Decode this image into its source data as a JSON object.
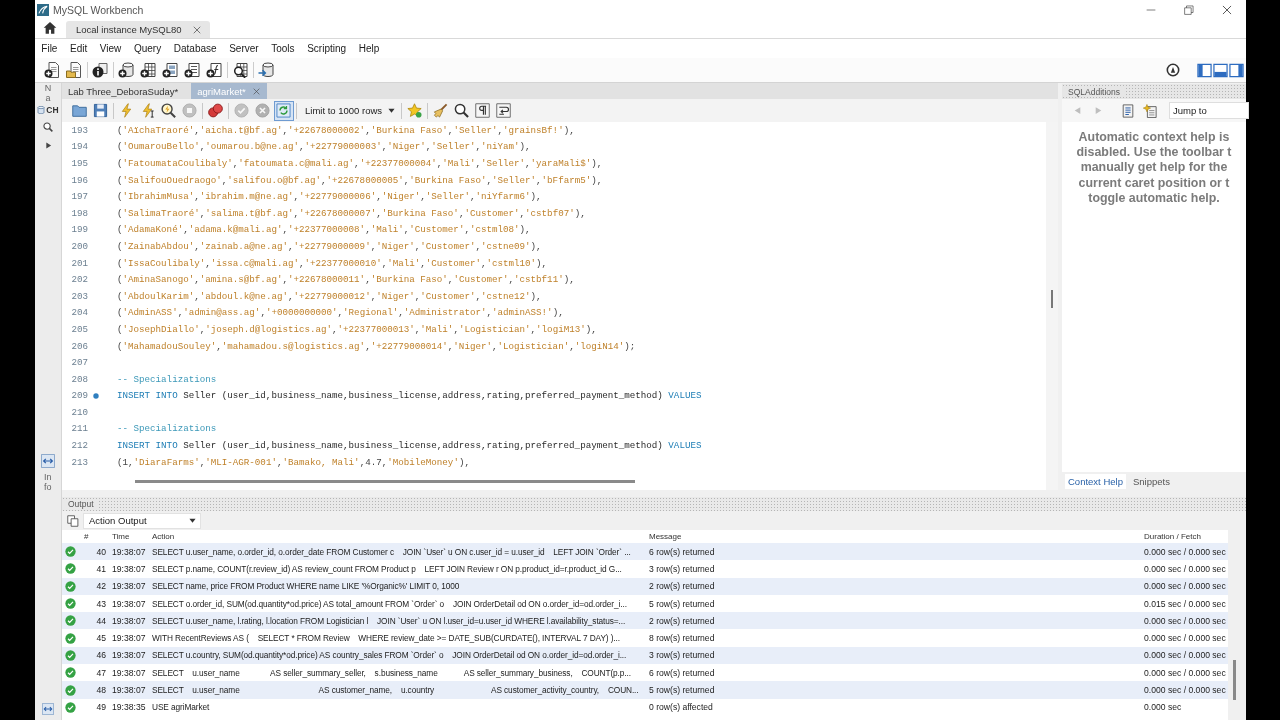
{
  "window": {
    "title": "MySQL Workbench"
  },
  "connection_tabs": [
    {
      "label": "Local instance MySQL80",
      "selected": true
    }
  ],
  "menu": [
    "File",
    "Edit",
    "View",
    "Query",
    "Database",
    "Server",
    "Tools",
    "Scripting",
    "Help"
  ],
  "sidebar": {
    "navigator_label": "Na",
    "schemas_label": "CH",
    "info_label": "Info"
  },
  "editor_tabs": [
    {
      "label": "Lab Three_DeboraSuday*",
      "selected": false
    },
    {
      "label": "agriMarket*",
      "selected": true
    }
  ],
  "editor_toolbar": [
    {
      "kind": "button",
      "disabled": false,
      "on": false
    },
    {
      "kind": "button",
      "disabled": false,
      "on": false
    },
    {
      "kind": "button",
      "disabled": false,
      "on": false
    },
    {
      "kind": "button",
      "disabled": false,
      "on": false
    },
    {
      "kind": "button",
      "disabled": false,
      "on": false
    },
    {
      "kind": "button",
      "disabled": true,
      "on": false
    },
    {
      "kind": "button",
      "disabled": false,
      "on": false
    },
    {
      "kind": "button",
      "disabled": true,
      "on": false
    },
    {
      "kind": "button",
      "disabled": true,
      "on": false
    },
    {
      "kind": "button",
      "disabled": false,
      "on": true
    },
    {
      "kind": "dropdown",
      "label": "Limit to 1000 rows"
    },
    {
      "kind": "button",
      "disabled": false,
      "on": false
    },
    {
      "kind": "button",
      "disabled": false,
      "on": false
    },
    {
      "kind": "button",
      "disabled": false,
      "on": false
    },
    {
      "kind": "button",
      "disabled": false,
      "on": false
    },
    {
      "kind": "button",
      "disabled": false,
      "on": false
    }
  ],
  "editor": {
    "lines": [
      {
        "number": "193",
        "marker": false,
        "tokens": [
          {
            "kind": "punct",
            "text": "("
          },
          {
            "kind": "string",
            "text": "'AïchaTraoré'"
          },
          {
            "kind": "punct",
            "text": ","
          },
          {
            "kind": "string",
            "text": "'aicha.t@bf.ag'"
          },
          {
            "kind": "punct",
            "text": ","
          },
          {
            "kind": "string",
            "text": "'+22678000002'"
          },
          {
            "kind": "punct",
            "text": ","
          },
          {
            "kind": "string",
            "text": "'Burkina Faso'"
          },
          {
            "kind": "punct",
            "text": ","
          },
          {
            "kind": "string",
            "text": "'Seller'"
          },
          {
            "kind": "punct",
            "text": ","
          },
          {
            "kind": "string",
            "text": "'grainsBf!'"
          },
          {
            "kind": "punct",
            "text": "),"
          }
        ]
      },
      {
        "number": "194",
        "marker": false,
        "tokens": [
          {
            "kind": "punct",
            "text": "("
          },
          {
            "kind": "string",
            "text": "'OumarouBello'"
          },
          {
            "kind": "punct",
            "text": ","
          },
          {
            "kind": "string",
            "text": "'oumarou.b@ne.ag'"
          },
          {
            "kind": "punct",
            "text": ","
          },
          {
            "kind": "string",
            "text": "'+22779000003'"
          },
          {
            "kind": "punct",
            "text": ","
          },
          {
            "kind": "string",
            "text": "'Niger'"
          },
          {
            "kind": "punct",
            "text": ","
          },
          {
            "kind": "string",
            "text": "'Seller'"
          },
          {
            "kind": "punct",
            "text": ","
          },
          {
            "kind": "string",
            "text": "'niYam'"
          },
          {
            "kind": "punct",
            "text": "),"
          }
        ]
      },
      {
        "number": "195",
        "marker": false,
        "tokens": [
          {
            "kind": "punct",
            "text": "("
          },
          {
            "kind": "string",
            "text": "'FatoumataCoulibaly'"
          },
          {
            "kind": "punct",
            "text": ","
          },
          {
            "kind": "string",
            "text": "'fatoumata.c@mali.ag'"
          },
          {
            "kind": "punct",
            "text": ","
          },
          {
            "kind": "string",
            "text": "'+22377000004'"
          },
          {
            "kind": "punct",
            "text": ","
          },
          {
            "kind": "string",
            "text": "'Mali'"
          },
          {
            "kind": "punct",
            "text": ","
          },
          {
            "kind": "string",
            "text": "'Seller'"
          },
          {
            "kind": "punct",
            "text": ","
          },
          {
            "kind": "string",
            "text": "'yaraMali$'"
          },
          {
            "kind": "punct",
            "text": "),"
          }
        ]
      },
      {
        "number": "196",
        "marker": false,
        "tokens": [
          {
            "kind": "punct",
            "text": "("
          },
          {
            "kind": "string",
            "text": "'SalifouOuedraogo'"
          },
          {
            "kind": "punct",
            "text": ","
          },
          {
            "kind": "string",
            "text": "'salifou.o@bf.ag'"
          },
          {
            "kind": "punct",
            "text": ","
          },
          {
            "kind": "string",
            "text": "'+22678000005'"
          },
          {
            "kind": "punct",
            "text": ","
          },
          {
            "kind": "string",
            "text": "'Burkina Faso'"
          },
          {
            "kind": "punct",
            "text": ","
          },
          {
            "kind": "string",
            "text": "'Seller'"
          },
          {
            "kind": "punct",
            "text": ","
          },
          {
            "kind": "string",
            "text": "'bFfarm5'"
          },
          {
            "kind": "punct",
            "text": "),"
          }
        ]
      },
      {
        "number": "197",
        "marker": false,
        "tokens": [
          {
            "kind": "punct",
            "text": "("
          },
          {
            "kind": "string",
            "text": "'IbrahimMusa'"
          },
          {
            "kind": "punct",
            "text": ","
          },
          {
            "kind": "string",
            "text": "'ibrahim.m@ne.ag'"
          },
          {
            "kind": "punct",
            "text": ","
          },
          {
            "kind": "string",
            "text": "'+22779000006'"
          },
          {
            "kind": "punct",
            "text": ","
          },
          {
            "kind": "string",
            "text": "'Niger'"
          },
          {
            "kind": "punct",
            "text": ","
          },
          {
            "kind": "string",
            "text": "'Seller'"
          },
          {
            "kind": "punct",
            "text": ","
          },
          {
            "kind": "string",
            "text": "'niYfarm6'"
          },
          {
            "kind": "punct",
            "text": "),"
          }
        ]
      },
      {
        "number": "198",
        "marker": false,
        "tokens": [
          {
            "kind": "punct",
            "text": "("
          },
          {
            "kind": "string",
            "text": "'SalimaTraoré'"
          },
          {
            "kind": "punct",
            "text": ","
          },
          {
            "kind": "string",
            "text": "'salima.t@bf.ag'"
          },
          {
            "kind": "punct",
            "text": ","
          },
          {
            "kind": "string",
            "text": "'+22678000007'"
          },
          {
            "kind": "punct",
            "text": ","
          },
          {
            "kind": "string",
            "text": "'Burkina Faso'"
          },
          {
            "kind": "punct",
            "text": ","
          },
          {
            "kind": "string",
            "text": "'Customer'"
          },
          {
            "kind": "punct",
            "text": ","
          },
          {
            "kind": "string",
            "text": "'cstbf07'"
          },
          {
            "kind": "punct",
            "text": "),"
          }
        ]
      },
      {
        "number": "199",
        "marker": false,
        "tokens": [
          {
            "kind": "punct",
            "text": "("
          },
          {
            "kind": "string",
            "text": "'AdamaKoné'"
          },
          {
            "kind": "punct",
            "text": ","
          },
          {
            "kind": "string",
            "text": "'adama.k@mali.ag'"
          },
          {
            "kind": "punct",
            "text": ","
          },
          {
            "kind": "string",
            "text": "'+22377000008'"
          },
          {
            "kind": "punct",
            "text": ","
          },
          {
            "kind": "string",
            "text": "'Mali'"
          },
          {
            "kind": "punct",
            "text": ","
          },
          {
            "kind": "string",
            "text": "'Customer'"
          },
          {
            "kind": "punct",
            "text": ","
          },
          {
            "kind": "string",
            "text": "'cstml08'"
          },
          {
            "kind": "punct",
            "text": "),"
          }
        ]
      },
      {
        "number": "200",
        "marker": false,
        "tokens": [
          {
            "kind": "punct",
            "text": "("
          },
          {
            "kind": "string",
            "text": "'ZainabAbdou'"
          },
          {
            "kind": "punct",
            "text": ","
          },
          {
            "kind": "string",
            "text": "'zainab.a@ne.ag'"
          },
          {
            "kind": "punct",
            "text": ","
          },
          {
            "kind": "string",
            "text": "'+22779000009'"
          },
          {
            "kind": "punct",
            "text": ","
          },
          {
            "kind": "string",
            "text": "'Niger'"
          },
          {
            "kind": "punct",
            "text": ","
          },
          {
            "kind": "string",
            "text": "'Customer'"
          },
          {
            "kind": "punct",
            "text": ","
          },
          {
            "kind": "string",
            "text": "'cstne09'"
          },
          {
            "kind": "punct",
            "text": "),"
          }
        ]
      },
      {
        "number": "201",
        "marker": false,
        "tokens": [
          {
            "kind": "punct",
            "text": "("
          },
          {
            "kind": "string",
            "text": "'IssaCoulibaly'"
          },
          {
            "kind": "punct",
            "text": ","
          },
          {
            "kind": "string",
            "text": "'issa.c@mali.ag'"
          },
          {
            "kind": "punct",
            "text": ","
          },
          {
            "kind": "string",
            "text": "'+22377000010'"
          },
          {
            "kind": "punct",
            "text": ","
          },
          {
            "kind": "string",
            "text": "'Mali'"
          },
          {
            "kind": "punct",
            "text": ","
          },
          {
            "kind": "string",
            "text": "'Customer'"
          },
          {
            "kind": "punct",
            "text": ","
          },
          {
            "kind": "string",
            "text": "'cstml10'"
          },
          {
            "kind": "punct",
            "text": "),"
          }
        ]
      },
      {
        "number": "202",
        "marker": false,
        "tokens": [
          {
            "kind": "punct",
            "text": "("
          },
          {
            "kind": "string",
            "text": "'AminaSanogo'"
          },
          {
            "kind": "punct",
            "text": ","
          },
          {
            "kind": "string",
            "text": "'amina.s@bf.ag'"
          },
          {
            "kind": "punct",
            "text": ","
          },
          {
            "kind": "string",
            "text": "'+22678000011'"
          },
          {
            "kind": "punct",
            "text": ","
          },
          {
            "kind": "string",
            "text": "'Burkina Faso'"
          },
          {
            "kind": "punct",
            "text": ","
          },
          {
            "kind": "string",
            "text": "'Customer'"
          },
          {
            "kind": "punct",
            "text": ","
          },
          {
            "kind": "string",
            "text": "'cstbf11'"
          },
          {
            "kind": "punct",
            "text": "),"
          }
        ]
      },
      {
        "number": "203",
        "marker": false,
        "tokens": [
          {
            "kind": "punct",
            "text": "("
          },
          {
            "kind": "string",
            "text": "'AbdoulKarim'"
          },
          {
            "kind": "punct",
            "text": ","
          },
          {
            "kind": "string",
            "text": "'abdoul.k@ne.ag'"
          },
          {
            "kind": "punct",
            "text": ","
          },
          {
            "kind": "string",
            "text": "'+22779000012'"
          },
          {
            "kind": "punct",
            "text": ","
          },
          {
            "kind": "string",
            "text": "'Niger'"
          },
          {
            "kind": "punct",
            "text": ","
          },
          {
            "kind": "string",
            "text": "'Customer'"
          },
          {
            "kind": "punct",
            "text": ","
          },
          {
            "kind": "string",
            "text": "'cstne12'"
          },
          {
            "kind": "punct",
            "text": "),"
          }
        ]
      },
      {
        "number": "204",
        "marker": false,
        "tokens": [
          {
            "kind": "punct",
            "text": "("
          },
          {
            "kind": "string",
            "text": "'AdminASS'"
          },
          {
            "kind": "punct",
            "text": ","
          },
          {
            "kind": "string",
            "text": "'admin@ass.ag'"
          },
          {
            "kind": "punct",
            "text": ","
          },
          {
            "kind": "string",
            "text": "'+0000000000'"
          },
          {
            "kind": "punct",
            "text": ","
          },
          {
            "kind": "string",
            "text": "'Regional'"
          },
          {
            "kind": "punct",
            "text": ","
          },
          {
            "kind": "string",
            "text": "'Administrator'"
          },
          {
            "kind": "punct",
            "text": ","
          },
          {
            "kind": "string",
            "text": "'adminASS!'"
          },
          {
            "kind": "punct",
            "text": "),"
          }
        ]
      },
      {
        "number": "205",
        "marker": false,
        "tokens": [
          {
            "kind": "punct",
            "text": "("
          },
          {
            "kind": "string",
            "text": "'JosephDiallo'"
          },
          {
            "kind": "punct",
            "text": ","
          },
          {
            "kind": "string",
            "text": "'joseph.d@logistics.ag'"
          },
          {
            "kind": "punct",
            "text": ","
          },
          {
            "kind": "string",
            "text": "'+22377000013'"
          },
          {
            "kind": "punct",
            "text": ","
          },
          {
            "kind": "string",
            "text": "'Mali'"
          },
          {
            "kind": "punct",
            "text": ","
          },
          {
            "kind": "string",
            "text": "'Logistician'"
          },
          {
            "kind": "punct",
            "text": ","
          },
          {
            "kind": "string",
            "text": "'logiM13'"
          },
          {
            "kind": "punct",
            "text": "),"
          }
        ]
      },
      {
        "number": "206",
        "marker": false,
        "tokens": [
          {
            "kind": "punct",
            "text": "("
          },
          {
            "kind": "string",
            "text": "'MahamadouSouley'"
          },
          {
            "kind": "punct",
            "text": ","
          },
          {
            "kind": "string",
            "text": "'mahamadou.s@logistics.ag'"
          },
          {
            "kind": "punct",
            "text": ","
          },
          {
            "kind": "string",
            "text": "'+22779000014'"
          },
          {
            "kind": "punct",
            "text": ","
          },
          {
            "kind": "string",
            "text": "'Niger'"
          },
          {
            "kind": "punct",
            "text": ","
          },
          {
            "kind": "string",
            "text": "'Logistician'"
          },
          {
            "kind": "punct",
            "text": ","
          },
          {
            "kind": "string",
            "text": "'logiN14'"
          },
          {
            "kind": "punct",
            "text": ");"
          }
        ]
      },
      {
        "number": "207",
        "marker": false
      },
      {
        "number": "208",
        "marker": false,
        "tokens": [
          {
            "kind": "comment",
            "text": "-- Specializations"
          }
        ]
      },
      {
        "number": "209",
        "marker": true,
        "tokens": [
          {
            "kind": "keyword",
            "text": "INSERT INTO"
          },
          {
            "kind": "plain",
            "text": " Seller (user_id,business_name,business_license,address,rating,preferred_payment_method) "
          },
          {
            "kind": "keyword",
            "text": "VALUES"
          }
        ]
      },
      {
        "number": "210",
        "marker": false
      },
      {
        "number": "211",
        "marker": false,
        "tokens": [
          {
            "kind": "comment",
            "text": "-- Specializations"
          }
        ]
      },
      {
        "number": "212",
        "marker": false,
        "tokens": [
          {
            "kind": "keyword",
            "text": "INSERT INTO"
          },
          {
            "kind": "plain",
            "text": " Seller (user_id,business_name,business_license,address,rating,preferred_payment_method) "
          },
          {
            "kind": "keyword",
            "text": "VALUES"
          }
        ]
      },
      {
        "number": "213",
        "marker": false,
        "tokens": [
          {
            "kind": "punct",
            "text": "("
          },
          {
            "kind": "number",
            "text": "1"
          },
          {
            "kind": "punct",
            "text": ","
          },
          {
            "kind": "string",
            "text": "'DiaraFarms'"
          },
          {
            "kind": "punct",
            "text": ","
          },
          {
            "kind": "string",
            "text": "'MLI-AGR-001'"
          },
          {
            "kind": "punct",
            "text": ","
          },
          {
            "kind": "string",
            "text": "'Bamako, Mali'"
          },
          {
            "kind": "punct",
            "text": ","
          },
          {
            "kind": "number",
            "text": "4.7"
          },
          {
            "kind": "punct",
            "text": ","
          },
          {
            "kind": "string",
            "text": "'MobileMoney'"
          },
          {
            "kind": "punct",
            "text": "),"
          }
        ]
      }
    ]
  },
  "sql_additions": {
    "title": "SQLAdditions",
    "nav_buttons": [
      {
        "disabled": true
      },
      {
        "disabled": true
      }
    ],
    "jump_placeholder": "Jump to",
    "help_lines": [
      "Automatic context help is",
      "disabled. Use the toolbar t",
      "manually get help for the",
      "current caret position or t",
      "toggle automatic help."
    ],
    "tabs": [
      {
        "label": "Context Help",
        "selected": true
      },
      {
        "label": "Snippets",
        "selected": false
      }
    ]
  },
  "output": {
    "title": "Output",
    "view": "Action Output",
    "columns": [
      "#",
      "Time",
      "Action",
      "Message",
      "Duration / Fetch"
    ],
    "rows": [
      {
        "success": true,
        "number": "40",
        "time": "19:38:07",
        "action": "SELECT u.user_name, o.order_id, o.order_date FROM Customer c    JOIN `User` u ON c.user_id = u.user_id    LEFT JOIN `Order` ...",
        "message": "6 row(s) returned",
        "duration": "0.000 sec / 0.000 sec"
      },
      {
        "success": true,
        "number": "41",
        "time": "19:38:07",
        "action": "SELECT p.name, COUNT(r.review_id) AS review_count FROM Product p    LEFT JOIN Review r ON p.product_id=r.product_id G...",
        "message": "3 row(s) returned",
        "duration": "0.000 sec / 0.000 sec"
      },
      {
        "success": true,
        "number": "42",
        "time": "19:38:07",
        "action": "SELECT name, price FROM Product WHERE name LIKE '%Organic%' LIMIT 0, 1000",
        "message": "2 row(s) returned",
        "duration": "0.000 sec / 0.000 sec"
      },
      {
        "success": true,
        "number": "43",
        "time": "19:38:07",
        "action": "SELECT o.order_id, SUM(od.quantity*od.price) AS total_amount FROM `Order` o    JOIN OrderDetail od ON o.order_id=od.order_i...",
        "message": "5 row(s) returned",
        "duration": "0.015 sec / 0.000 sec"
      },
      {
        "success": true,
        "number": "44",
        "time": "19:38:07",
        "action": "SELECT u.user_name, l.rating, l.location FROM Logistician l    JOIN `User` u ON l.user_id=u.user_id WHERE l.availability_status=...",
        "message": "2 row(s) returned",
        "duration": "0.000 sec / 0.000 sec"
      },
      {
        "success": true,
        "number": "45",
        "time": "19:38:07",
        "action": "WITH RecentReviews AS (    SELECT * FROM Review    WHERE review_date >= DATE_SUB(CURDATE(), INTERVAL 7 DAY) )...",
        "message": "8 row(s) returned",
        "duration": "0.000 sec / 0.000 sec"
      },
      {
        "success": true,
        "number": "46",
        "time": "19:38:07",
        "action": "SELECT u.country, SUM(od.quantity*od.price) AS country_sales FROM `Order` o    JOIN OrderDetail od ON o.order_id=od.order_i...",
        "message": "3 row(s) returned",
        "duration": "0.000 sec / 0.000 sec"
      },
      {
        "success": true,
        "number": "47",
        "time": "19:38:07",
        "action": "SELECT    u.user_name              AS seller_summary_seller,    s.business_name            AS seller_summary_business,    COUNT(p.p...",
        "message": "6 row(s) returned",
        "duration": "0.000 sec / 0.000 sec"
      },
      {
        "success": true,
        "number": "48",
        "time": "19:38:07",
        "action": "SELECT    u.user_name                                    AS customer_name,    u.country                          AS customer_activity_country,    COUN...",
        "message": "5 row(s) returned",
        "duration": "0.000 sec / 0.000 sec"
      },
      {
        "success": true,
        "number": "49",
        "time": "19:38:35",
        "action": "USE agriMarket",
        "message": "0 row(s) affected",
        "duration": "0.000 sec"
      }
    ]
  }
}
